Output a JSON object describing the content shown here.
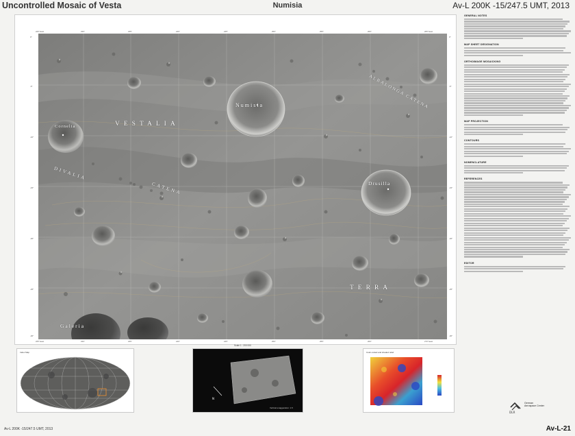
{
  "header": {
    "left_title": "Uncontrolled Mosaic of Vesta",
    "center_title": "Numisia",
    "right_title": "Av-L 200K -15/247.5 UMT, 2013"
  },
  "map": {
    "labels": {
      "numisia": "Numisia",
      "vestalia": "VESTALIA",
      "terra": "TERRA",
      "divalia": "DIVALIA",
      "catena_left": "CATENA",
      "albalonga": "ALBALONGA",
      "catena_right": "CATENA",
      "cornelia": "Cornelia",
      "drusilla": "Drusilla",
      "galeria": "Galeria"
    },
    "grid": {
      "top_lon": [
        "225° East",
        "230°",
        "235°",
        "240°",
        "245°",
        "250°",
        "255°",
        "260°",
        "265° East"
      ],
      "bottom_lon": [
        "225° East",
        "230°",
        "235°",
        "240°",
        "245°",
        "250°",
        "255°",
        "260°",
        "270° East"
      ],
      "left_lat": [
        "0°",
        "-5°",
        "-10°",
        "-15°",
        "-20°",
        "-25°",
        "-30°"
      ],
      "right_lat": [
        "0°",
        "-5°",
        "-10°",
        "-15°",
        "-20°",
        "-25°",
        "-30°"
      ]
    },
    "scale": {
      "label": "Scale 1 : 200 000",
      "ticks": [
        "0",
        "5",
        "10",
        "15",
        "20 km"
      ]
    }
  },
  "notes": {
    "sections": [
      {
        "title": "GENERAL NOTES",
        "lines": 9
      },
      {
        "title": "MAP SHEET DESIGNATION",
        "lines": 4
      },
      {
        "title": "ORTHOIMAGE MOSAICKING",
        "lines": 22
      },
      {
        "title": "MAP PROJECTION",
        "lines": 5
      },
      {
        "title": "CONTOURS",
        "lines": 6
      },
      {
        "title": "NOMENCLATURE",
        "lines": 4
      },
      {
        "title": "REFERENCES",
        "lines": 32
      },
      {
        "title": "EDITOR",
        "lines": 3
      }
    ]
  },
  "insets": {
    "index_caption": "Index Map",
    "perspective_caption": "Perspective view",
    "perspective_sub": "Vertical exaggeration: 1.5",
    "color_caption": "Color-coded and shaded relief"
  },
  "footer": {
    "left": "Av-L 200K -15/247.5 UMT, 2013",
    "right": "Av-L-21",
    "logo_line1": "German",
    "logo_line2": "Aerospace Center",
    "logo_mark": "DLR"
  },
  "colors": {
    "map_grey": "#8d8d8b",
    "relief_red": "#d8242a",
    "relief_blue": "#2a48c4",
    "relief_yellow": "#f2e13a"
  }
}
